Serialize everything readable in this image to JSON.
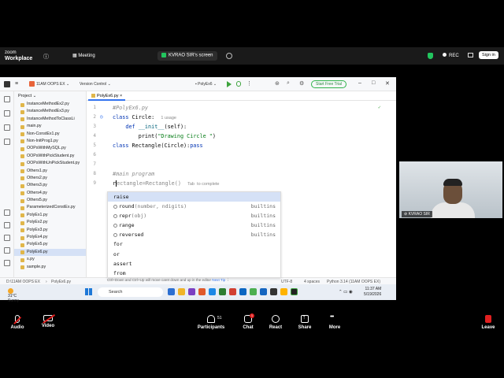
{
  "zoom": {
    "brand_top": "zoom",
    "brand_bottom": "Workplace",
    "meeting_label": "Meeting",
    "share_label": "KVRAO SIR's screen",
    "rec_label": "REC",
    "sign_in": "Sign in",
    "controls": [
      {
        "label": "Audio",
        "icon": "mic-muted-icon"
      },
      {
        "label": "Video",
        "icon": "camera-off-icon"
      },
      {
        "label": "Participants",
        "count": "51",
        "icon": "participants-icon"
      },
      {
        "label": "Chat",
        "badge": "1",
        "icon": "chat-icon"
      },
      {
        "label": "React",
        "icon": "react-icon"
      },
      {
        "label": "Share",
        "icon": "share-icon"
      },
      {
        "label": "More",
        "icon": "more-icon"
      },
      {
        "label": "Leave",
        "icon": "leave-icon"
      }
    ],
    "participant_name": "KVRAO SIR"
  },
  "ide": {
    "project_name": "11AM OOPS EX",
    "version_control": "Version Control",
    "run_config": "PolyEx6",
    "trial_button": "Start Free Trial",
    "project_label": "Project",
    "tree": [
      "InstanceMethodEx2.py",
      "InstanceMethodEx3.py",
      "InstanceMethodToClassLi",
      "main.py",
      "Non-ConstEx1.py",
      "Non-InitProg1.py",
      "OOPsWithMySQL.py",
      "OOPsWithPickStudent.py",
      "OOPsWithUnPickStudent.py",
      "Others1.py",
      "Others2.py",
      "Others3.py",
      "Others4.py",
      "Others5.py",
      "ParameterizedConstEx.py",
      "PolyEx1.py",
      "PolyEx2.py",
      "PolyEx3.py",
      "PolyEx4.py",
      "PolyEx5.py",
      "PolyEx6.py",
      "s.py",
      "sample.py"
    ],
    "selected_file_index": 20,
    "tab_label": "PolyEx6.py",
    "code": {
      "l1": "#PolyEx6.py",
      "l2_kw": "class",
      "l2_name": " Circle:",
      "l2_hint": "1 usage",
      "l3_kw": "def",
      "l3_fn": " __init__",
      "l3_rest": "(self):",
      "l4_fn": "print",
      "l4_str": "\"Drawing Circle \"",
      "l5_kw": "class",
      "l5_rest": " Rectangle(Circle):",
      "l5_kw2": "pass",
      "l8": "#main program",
      "l9_rest": "ectangle=Rectangle()",
      "l9_first": "r",
      "l9_hint": "Tab  to complete"
    },
    "line_numbers": [
      "1",
      "2",
      "3",
      "4",
      "5",
      "6",
      "7",
      "8",
      "9"
    ],
    "autocomplete": [
      {
        "name": "raise",
        "sig": "",
        "src": ""
      },
      {
        "name": "round",
        "sig": "(number, ndigits)",
        "src": "builtins"
      },
      {
        "name": "repr",
        "sig": "(obj)",
        "src": "builtins"
      },
      {
        "name": "range",
        "sig": "",
        "src": "builtins"
      },
      {
        "name": "reversed",
        "sig": "",
        "src": "builtins"
      },
      {
        "name": "for",
        "sig": "",
        "src": ""
      },
      {
        "name": "or",
        "sig": "",
        "src": ""
      },
      {
        "name": "assert",
        "sig": "",
        "src": ""
      },
      {
        "name": "from",
        "sig": "",
        "src": ""
      }
    ],
    "ac_footer": "Ctrl+Down and Ctrl+Up will move caret down and up in the editor",
    "ac_footer_next": "Next Tip",
    "status_path": "D:\\11AM OOPS EX",
    "status_file": "PolyEx6.py",
    "status_enc": "UTF-8",
    "status_indent": "4 spaces",
    "status_python": "Python 3.14 (11AM OOPS EX)"
  },
  "taskbar": {
    "temp": "31°C",
    "weather": "Sunny",
    "search": "Search",
    "time": "11:37 AM",
    "date": "5/19/2026"
  }
}
